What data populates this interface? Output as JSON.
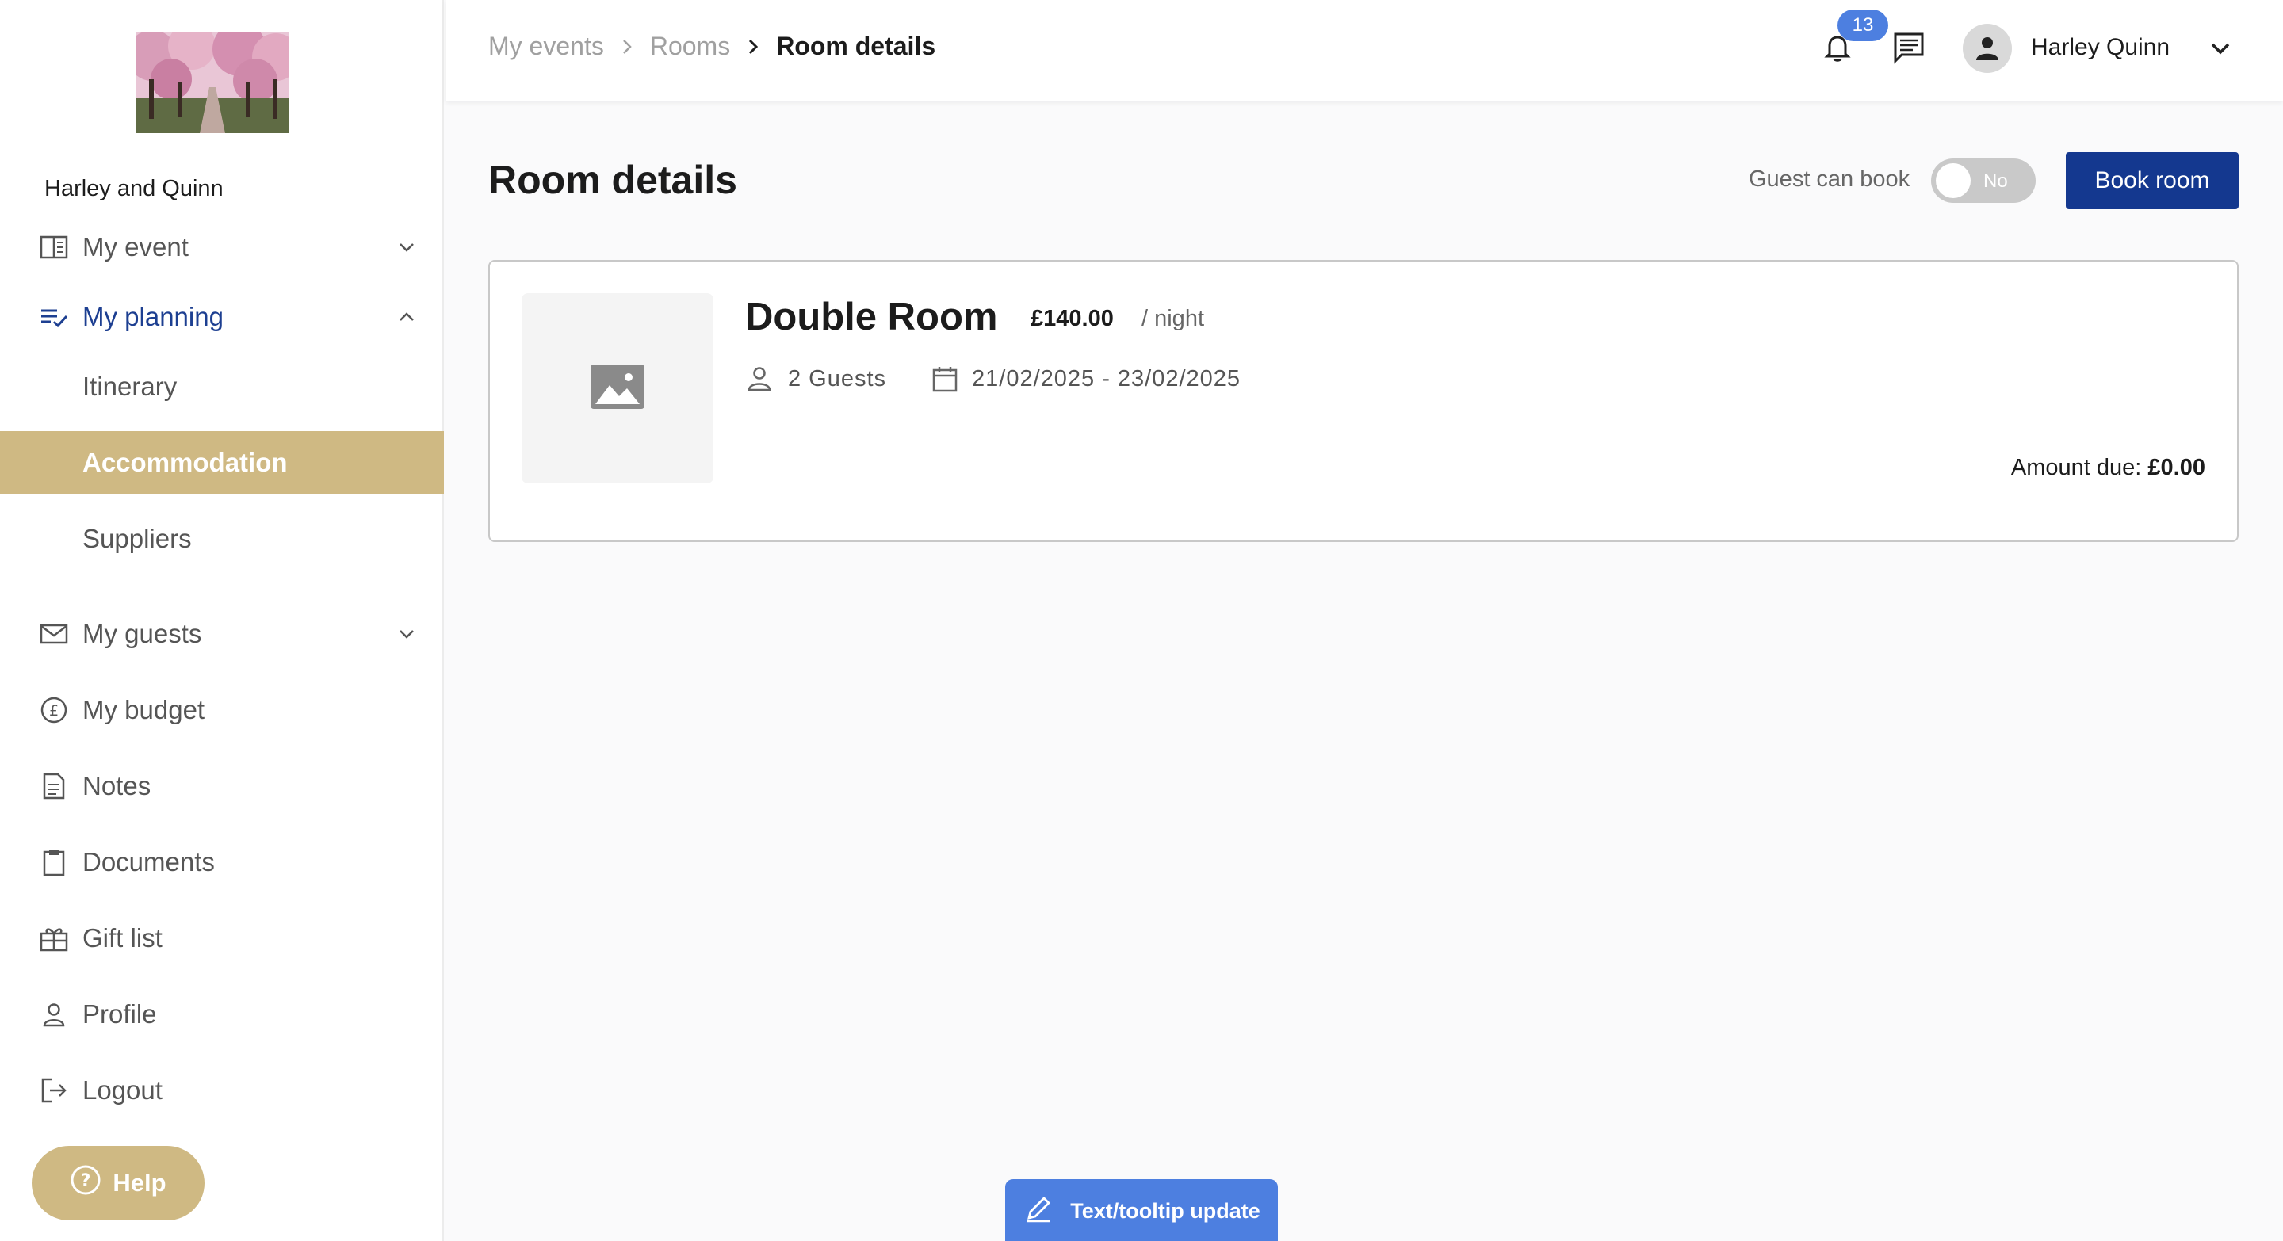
{
  "sidebar": {
    "event_name": "Harley and Quinn",
    "items": [
      {
        "label": "My event",
        "icon": "book-open-icon"
      },
      {
        "label": "My planning",
        "icon": "checklist-icon"
      },
      {
        "label": "Itinerary"
      },
      {
        "label": "Accommodation"
      },
      {
        "label": "Suppliers"
      },
      {
        "label": "My guests",
        "icon": "mail-icon"
      },
      {
        "label": "My budget",
        "icon": "pound-coin-icon"
      },
      {
        "label": "Notes",
        "icon": "note-icon"
      },
      {
        "label": "Documents",
        "icon": "clipboard-icon"
      },
      {
        "label": "Gift list",
        "icon": "gift-icon"
      },
      {
        "label": "Profile",
        "icon": "person-icon"
      },
      {
        "label": "Logout",
        "icon": "logout-icon"
      }
    ],
    "help_label": "Help"
  },
  "header": {
    "breadcrumb": [
      "My events",
      "Rooms",
      "Room details"
    ],
    "notification_count": "13",
    "user_name": "Harley Quinn"
  },
  "main": {
    "title": "Room details",
    "guest_can_book_label": "Guest can book",
    "toggle_value": "No",
    "book_button": "Book room",
    "room": {
      "name": "Double Room",
      "price": "£140.00",
      "per": "/ night",
      "guests": "2 Guests",
      "dates": "21/02/2025 - 23/02/2025",
      "amount_due_label": "Amount due:",
      "amount_due_value": "£0.00"
    }
  },
  "footer": {
    "tooltip_update": "Text/tooltip update"
  },
  "colors": {
    "accent_gold": "#cfb983",
    "primary_navy": "#14388f",
    "badge_blue": "#4d7fe0"
  }
}
